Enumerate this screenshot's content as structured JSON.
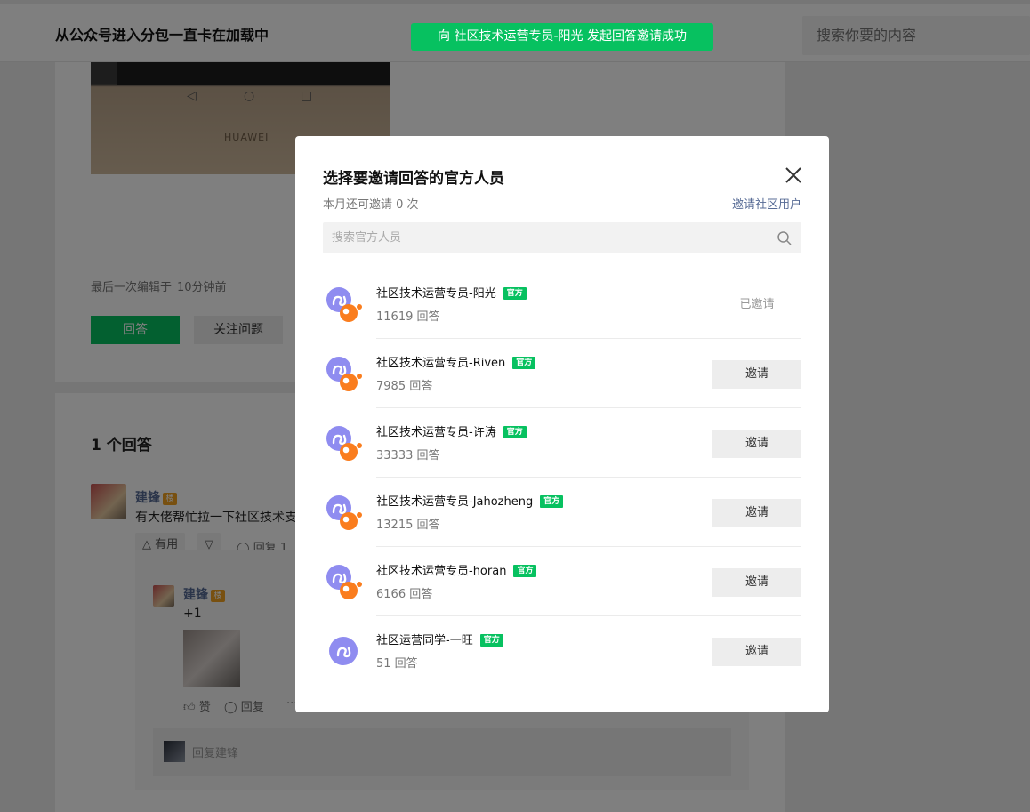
{
  "page": {
    "question_title": "从公众号进入分包一直卡在加载中",
    "search_placeholder": "搜索你要的内容",
    "toast": "向 社区技术运营专员-阳光 发起回答邀请成功",
    "photo_brand": "HUAWEI",
    "last_edited_label": "最后一次编辑于",
    "last_edited_time": "10分钟前",
    "answer_button": "回答",
    "follow_button": "关注问题",
    "answer_count": "1 个回答",
    "answer": {
      "user": "建锋",
      "level": "楼",
      "content": "有大佬帮忙拉一下社区技术支",
      "useful_label": "△ 有用",
      "down_icon": "▽",
      "reply_label": "回复 1"
    },
    "reply": {
      "user": "建锋",
      "level": "楼",
      "content": "+1",
      "like_label": "赞",
      "reply_label": "回复",
      "more": "···",
      "input_placeholder": "回复建锋"
    }
  },
  "dialog": {
    "title": "选择要邀请回答的官方人员",
    "quota": "本月还可邀请 0 次",
    "invite_community_link": "邀请社区用户",
    "search_placeholder": "搜索官方人员",
    "badge_label": "官方",
    "staff": [
      {
        "name": "社区技术运营专员-阳光",
        "answers": "11619 回答",
        "action": "已邀请",
        "invited": true,
        "icon": "miniprogram-logo-icon"
      },
      {
        "name": "社区技术运营专员-Riven",
        "answers": "7985 回答",
        "action": "邀请",
        "invited": false,
        "icon": "miniprogram-logo-icon"
      },
      {
        "name": "社区技术运营专员-许涛",
        "answers": "33333 回答",
        "action": "邀请",
        "invited": false,
        "icon": "miniprogram-logo-icon"
      },
      {
        "name": "社区技术运营专员-Jahozheng",
        "answers": "13215 回答",
        "action": "邀请",
        "invited": false,
        "icon": "miniprogram-logo-icon"
      },
      {
        "name": "社区技术运营专员-horan",
        "answers": "6166 回答",
        "action": "邀请",
        "invited": false,
        "icon": "miniprogram-logo-icon"
      },
      {
        "name": "社区运营同学-一旺",
        "answers": "51 回答",
        "action": "邀请",
        "invited": false,
        "icon": "miniprogram-logo-plain-icon"
      }
    ]
  },
  "colors": {
    "brand_green": "#07c160",
    "link_blue": "#576b95",
    "logo_purple": "#8f8cf0",
    "logo_orange": "#fa7d1e"
  }
}
